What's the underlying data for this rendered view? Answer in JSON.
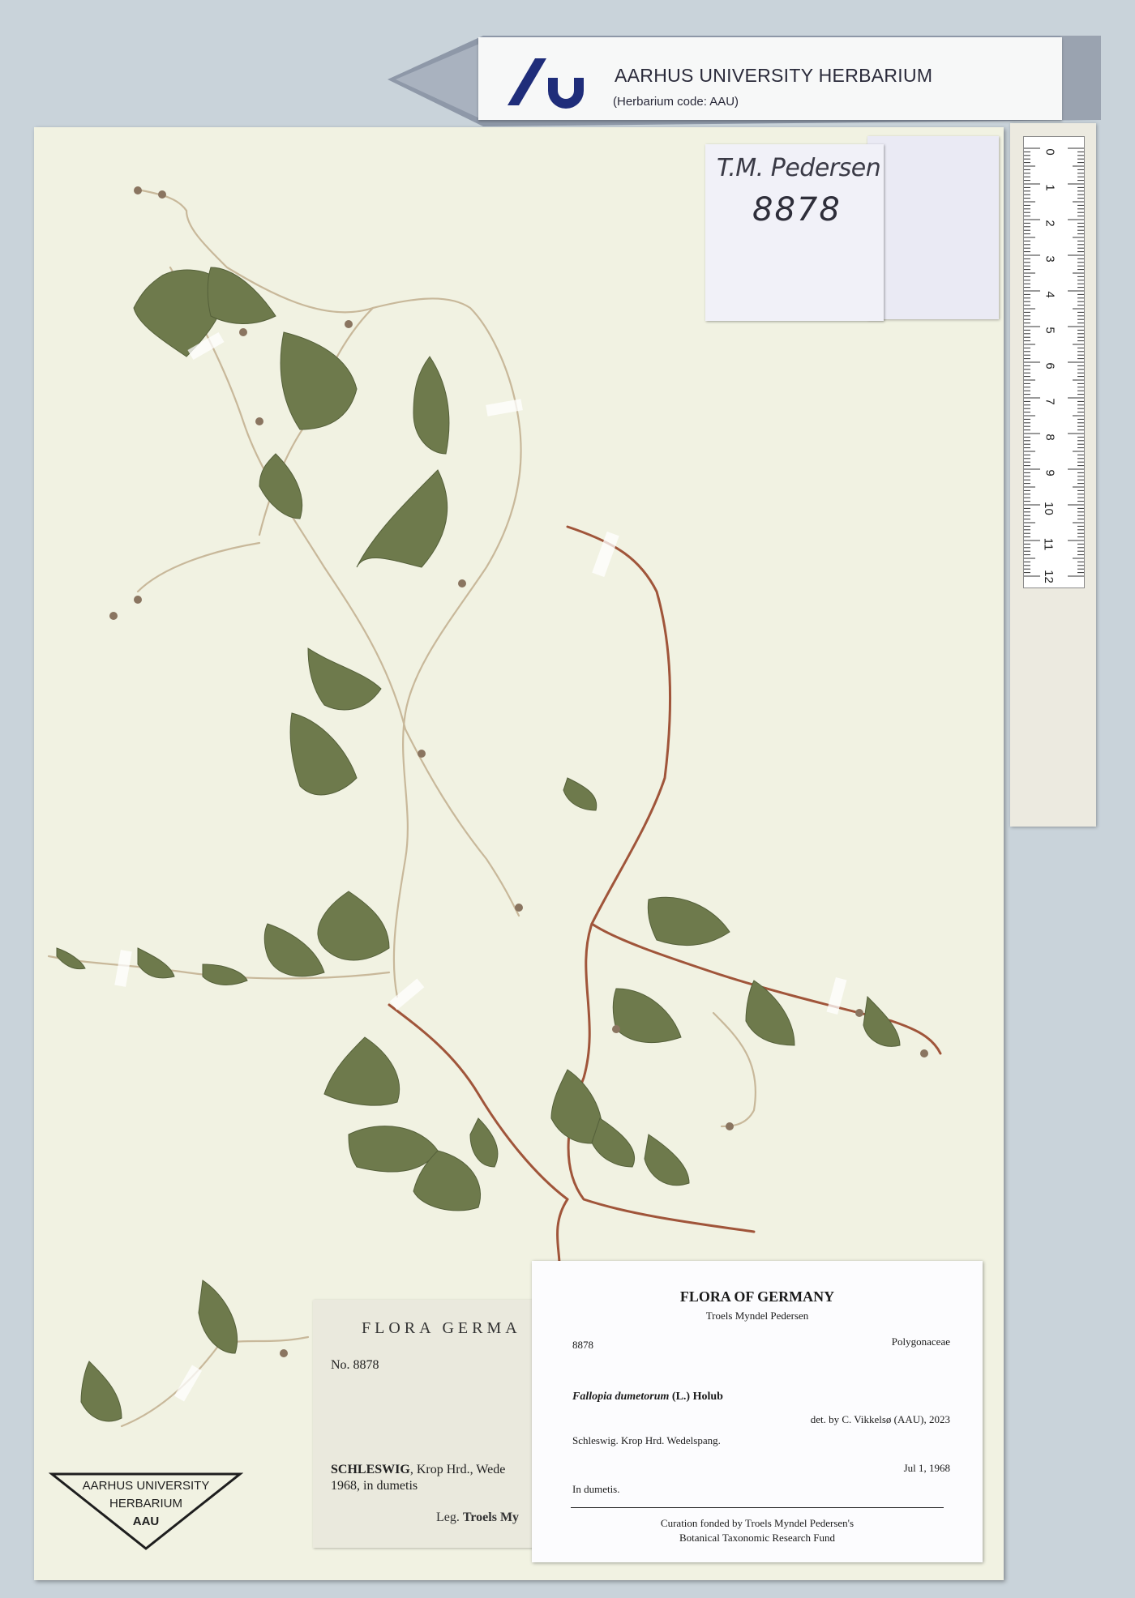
{
  "banner": {
    "title": "AARHUS UNIVERSITY HERBARIUM",
    "code": "(Herbarium code: AAU)",
    "logo_color": "#1f2d7a"
  },
  "collector_label": {
    "name": "T.M. Pedersen",
    "number": "8878"
  },
  "ruler": {
    "ticks": [
      "0",
      "1",
      "2",
      "3",
      "4",
      "5",
      "6",
      "7",
      "8",
      "9",
      "10",
      "11",
      "12"
    ]
  },
  "old_label": {
    "title": "FLORA GERMA",
    "number": "No. 8878",
    "locality_bold": "SCHLESWIG",
    "locality": ", Krop Hrd., Wede",
    "date_habitat": "1968, in dumetis",
    "leg_prefix": "Leg. ",
    "leg_name": "Troels My"
  },
  "det_label": {
    "title": "FLORA OF GERMANY",
    "collector": "Troels Myndel Pedersen",
    "number": "8878",
    "family": "Polygonaceae",
    "genus_species": "Fallopia dumetorum",
    "authority": " (L.) Holub",
    "determiner": "det. by C. Vikkelsø (AAU), 2023",
    "locality": "Schleswig. Krop Hrd. Wedelspang.",
    "date": "Jul 1, 1968",
    "habitat": "In dumetis.",
    "footer_line1": "Curation fonded by Troels Myndel Pedersen's",
    "footer_line2": "Botanical Taxonomic Research Fund"
  },
  "stamp": {
    "line1": "AARHUS UNIVERSITY",
    "line2": "HERBARIUM",
    "line3": "AAU"
  },
  "colors": {
    "sheet": "#f1f2e2",
    "leaf": "#6e7a4c",
    "stem": "#a0553a",
    "background": "#c9d3da"
  }
}
